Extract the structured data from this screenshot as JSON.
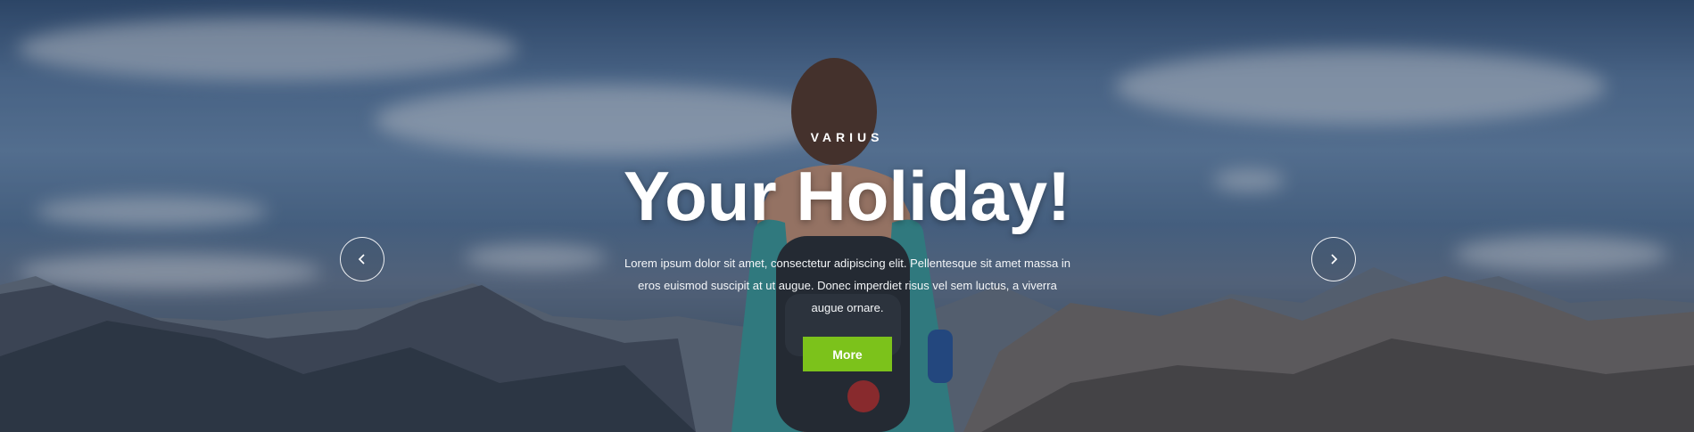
{
  "hero": {
    "eyebrow": "VARIUS",
    "title": "Your Holiday!",
    "description": "Lorem ipsum dolor sit amet, consectetur adipiscing elit. Pellentesque sit amet massa in eros euismod suscipit at ut augue. Donec imperdiet risus vel sem luctus, a viverra augue ornare.",
    "button_label": "More",
    "colors": {
      "button": "#7cc21b",
      "text": "#ffffff"
    }
  },
  "carousel": {
    "prev_icon": "chevron-left-icon",
    "next_icon": "chevron-right-icon"
  }
}
